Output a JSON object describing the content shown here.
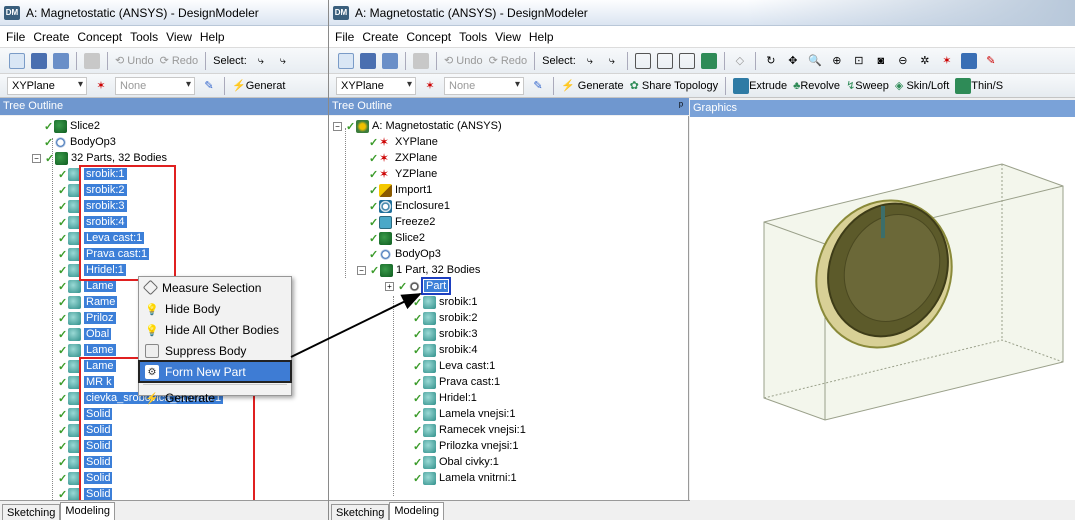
{
  "window_title": "A: Magnetostatic (ANSYS) - DesignModeler",
  "app_icon": "DM",
  "menu": [
    "File",
    "Create",
    "Concept",
    "Tools",
    "View",
    "Help"
  ],
  "toolbar": {
    "undo": "Undo",
    "redo": "Redo",
    "select": "Select:",
    "generate": "Generate",
    "generate_short": "Generat",
    "share_topology": "Share Topology",
    "extrude": "Extrude",
    "revolve": "Revolve",
    "sweep": "Sweep",
    "skin_loft": "Skin/Loft",
    "thin": "Thin/S",
    "plane_value": "XYPlane",
    "sketch_value": "None"
  },
  "tree_header": "Tree Outline",
  "graphics_header": "Graphics",
  "pin": "ᵖ",
  "left_tree": [
    {
      "label": "Slice2",
      "icon": "bodies"
    },
    {
      "label": "BodyOp3",
      "icon": "op"
    },
    {
      "label": "32 Parts, 32 Bodies",
      "icon": "bodies"
    },
    {
      "label": "srobik:1"
    },
    {
      "label": "srobik:2"
    },
    {
      "label": "srobik:3"
    },
    {
      "label": "srobik:4"
    },
    {
      "label": "Leva cast:1"
    },
    {
      "label": "Prava cast:1"
    },
    {
      "label": "Hridel:1"
    },
    {
      "label": "Lame"
    },
    {
      "label": "Rame"
    },
    {
      "label": "Priloz"
    },
    {
      "label": "Obal"
    },
    {
      "label": "Lame"
    },
    {
      "label": "Lame"
    },
    {
      "label": "MR k"
    },
    {
      "label": "cievka_srobovica_stvorec:1"
    },
    {
      "label": "Solid"
    },
    {
      "label": "Solid"
    },
    {
      "label": "Solid"
    },
    {
      "label": "Solid"
    },
    {
      "label": "Solid"
    },
    {
      "label": "Solid"
    }
  ],
  "context_menu": [
    {
      "label": "Measure Selection",
      "icon": "ruler-icon"
    },
    {
      "label": "Hide Body",
      "icon": "bulb-icon"
    },
    {
      "label": "Hide All Other Bodies",
      "icon": "bulb-icon"
    },
    {
      "label": "Suppress Body",
      "icon": "suppress-icon"
    },
    {
      "label": "Form New Part",
      "icon": "form-part-icon"
    },
    {
      "label": "Generate",
      "icon": "lightning-icon"
    }
  ],
  "right_tree": [
    {
      "label": "A: Magnetostatic (ANSYS)",
      "icon": "root"
    },
    {
      "label": "XYPlane",
      "icon": "plane"
    },
    {
      "label": "ZXPlane",
      "icon": "plane"
    },
    {
      "label": "YZPlane",
      "icon": "plane"
    },
    {
      "label": "Import1",
      "icon": "imp"
    },
    {
      "label": "Enclosure1",
      "icon": "enc"
    },
    {
      "label": "Freeze2",
      "icon": "frz"
    },
    {
      "label": "Slice2",
      "icon": "bodies"
    },
    {
      "label": "BodyOp3",
      "icon": "op"
    },
    {
      "label": "1 Part, 32 Bodies",
      "icon": "bodies"
    },
    {
      "label": "Part",
      "icon": "part"
    },
    {
      "label": "srobik:1"
    },
    {
      "label": "srobik:2"
    },
    {
      "label": "srobik:3"
    },
    {
      "label": "srobik:4"
    },
    {
      "label": "Leva cast:1"
    },
    {
      "label": "Prava cast:1"
    },
    {
      "label": "Hridel:1"
    },
    {
      "label": "Lamela vnejsi:1"
    },
    {
      "label": "Ramecek vnejsi:1"
    },
    {
      "label": "Prilozka vnejsi:1"
    },
    {
      "label": "Obal civky:1"
    },
    {
      "label": "Lamela vnitrni:1"
    }
  ],
  "tabs": {
    "sketching": "Sketching",
    "modeling": "Modeling"
  },
  "colors": {
    "selection": "#3c7fd8",
    "red_outline": "#e02020",
    "blue_outline": "#1d3fc0",
    "pane_header": "#6f97cf"
  }
}
